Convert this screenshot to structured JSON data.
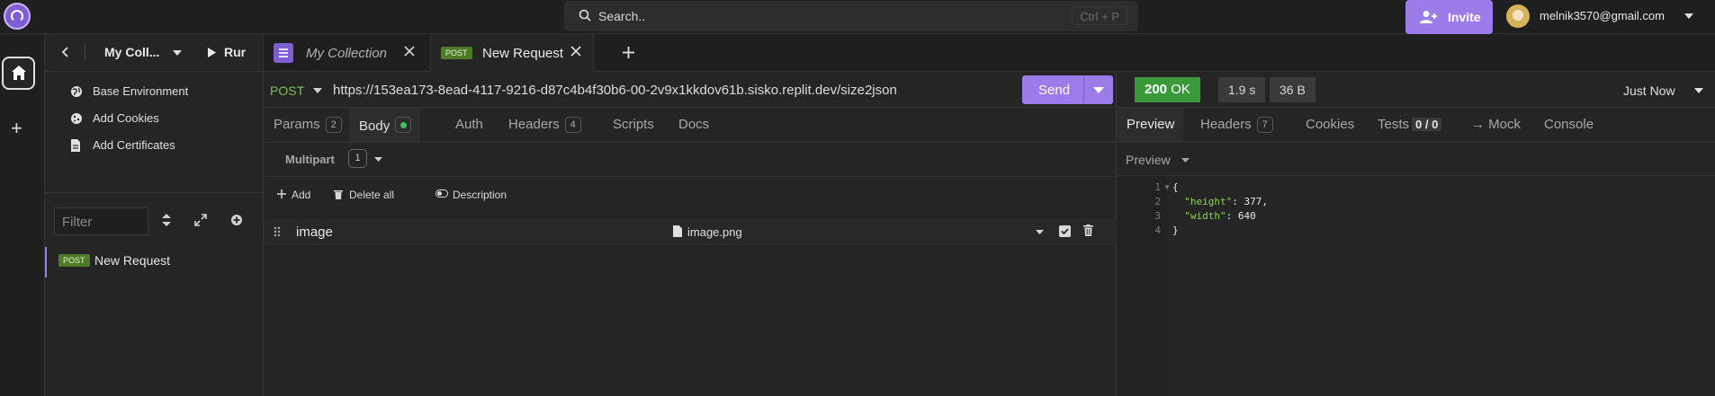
{
  "topbar": {
    "search_placeholder": "Search..",
    "search_shortcut": "Ctrl + P",
    "invite_label": "Invite",
    "user_email": "melnik3570@gmail.com"
  },
  "sidebar": {
    "collection_name": "My Coll...",
    "run_label": "Rur",
    "items": [
      {
        "label": "Base Environment",
        "icon": "globe-icon"
      },
      {
        "label": "Add Cookies",
        "icon": "cookie-icon"
      },
      {
        "label": "Add Certificates",
        "icon": "certificate-icon"
      }
    ],
    "filter_placeholder": "Filter",
    "request": {
      "method": "POST",
      "name": "New Request"
    }
  },
  "tabs": [
    {
      "label": "My Collection",
      "type": "collection"
    },
    {
      "label": "New Request",
      "method": "POST",
      "active": true
    }
  ],
  "request": {
    "method": "POST",
    "url": "https://153ea173-8ead-4117-9216-d87c4b4f30b6-00-2v9x1kkdov61b.sisko.replit.dev/size2json",
    "send_label": "Send",
    "tabs": {
      "params": {
        "label": "Params",
        "count": "2"
      },
      "body": {
        "label": "Body"
      },
      "auth": {
        "label": "Auth"
      },
      "headers": {
        "label": "Headers",
        "count": "4"
      },
      "scripts": {
        "label": "Scripts"
      },
      "docs": {
        "label": "Docs"
      }
    },
    "body_type": "Multipart",
    "body_count": "1",
    "actions": {
      "add": "Add",
      "delete_all": "Delete all",
      "description": "Description"
    },
    "params": [
      {
        "name": "image",
        "file": "image.png",
        "enabled": true
      }
    ]
  },
  "response": {
    "status_code": "200",
    "status_text": "OK",
    "time": "1.9 s",
    "size": "36 B",
    "ago": "Just Now",
    "tabs": {
      "preview": {
        "label": "Preview"
      },
      "headers": {
        "label": "Headers",
        "count": "7"
      },
      "cookies": {
        "label": "Cookies"
      },
      "tests": {
        "label": "Tests",
        "count": "0 / 0"
      },
      "mock": {
        "label": "→ Mock"
      },
      "console": {
        "label": "Console"
      }
    },
    "preview_mode": "Preview",
    "lines": [
      "1",
      "2",
      "3",
      "4"
    ],
    "json": {
      "open": "{",
      "height_key": "\"height\"",
      "height_val": "377",
      "width_key": "\"width\"",
      "width_val": "640",
      "close": "}"
    }
  },
  "colors": {
    "accent": "#9b7ce8",
    "post_method": "#7bc24e",
    "status_ok": "#3a9a3a",
    "background": "#252526"
  }
}
